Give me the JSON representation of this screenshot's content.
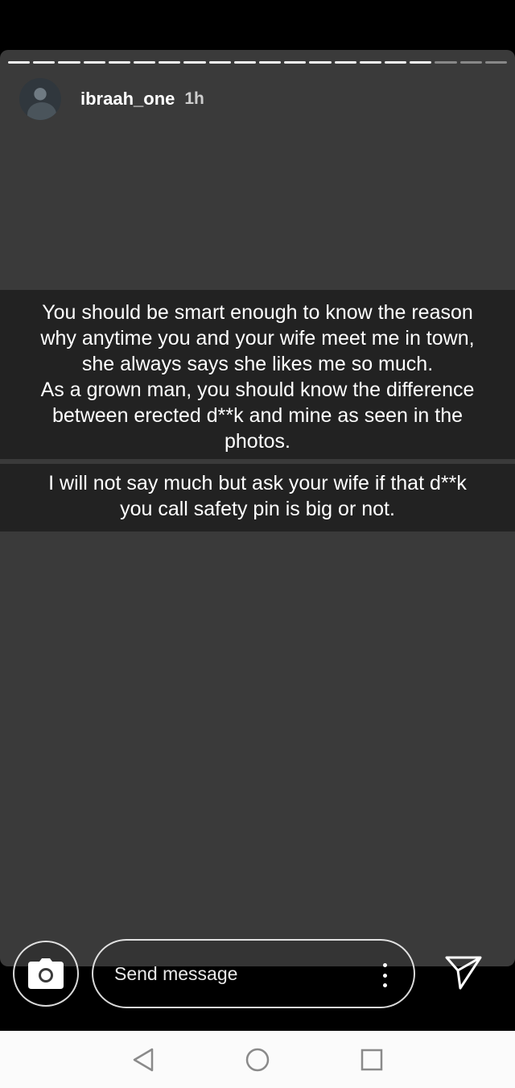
{
  "story": {
    "username": "ibraah_one",
    "time": "1h",
    "progress": {
      "total_segments": 20,
      "completed_segments": 17
    },
    "text_block_1": "You should be smart enough to know the reason\nwhy anytime you and your wife meet me in town,\nshe always says she likes me so much.\nAs a grown man, you should know the difference\nbetween erected d**k and mine as seen in the\nphotos.",
    "text_block_2": "I will not say much but ask your wife if that d**k\nyou call safety pin is big or not."
  },
  "composer": {
    "message_placeholder": "Send message",
    "camera_icon": "camera-icon",
    "more_icon": "more-vertical-icon",
    "send_icon": "send-icon"
  },
  "system_nav": {
    "back_icon": "back-triangle-icon",
    "home_icon": "home-circle-icon",
    "recents_icon": "recents-square-icon"
  },
  "colors": {
    "story_background": "#3a3a3a",
    "text_highlight": "#222222",
    "navbar_background": "#fbfbfb"
  }
}
